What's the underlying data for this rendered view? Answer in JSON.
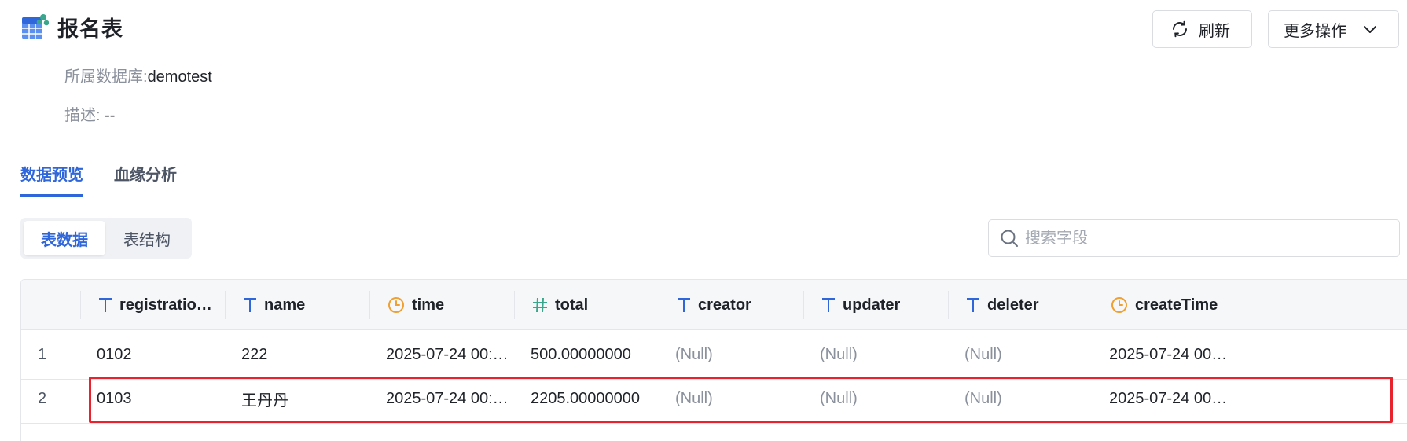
{
  "header": {
    "title": "报名表",
    "db_label": "所属数据库:",
    "db_value": "demotest",
    "desc_label": "描述:",
    "desc_value": "--"
  },
  "actions": {
    "refresh_label": "刷新",
    "more_label": "更多操作"
  },
  "tabs": [
    {
      "label": "数据预览",
      "active": true
    },
    {
      "label": "血缘分析",
      "active": false
    }
  ],
  "segment": {
    "items": [
      {
        "label": "表数据",
        "active": true
      },
      {
        "label": "表结构",
        "active": false
      }
    ]
  },
  "search": {
    "placeholder": "搜索字段",
    "value": ""
  },
  "table": {
    "columns": [
      {
        "label": "registratio…",
        "type": "text"
      },
      {
        "label": "name",
        "type": "text"
      },
      {
        "label": "time",
        "type": "datetime"
      },
      {
        "label": "total",
        "type": "number"
      },
      {
        "label": "creator",
        "type": "text"
      },
      {
        "label": "updater",
        "type": "text"
      },
      {
        "label": "deleter",
        "type": "text"
      },
      {
        "label": "createTime",
        "type": "datetime"
      }
    ],
    "rows": [
      {
        "index": "1",
        "cells": [
          "0102",
          "222",
          "2025-07-24 00:…",
          "500.00000000",
          "(Null)",
          "(Null)",
          "(Null)",
          "2025-07-24 00:…"
        ],
        "selected": false
      },
      {
        "index": "2",
        "cells": [
          "0103",
          "王丹丹",
          "2025-07-24 00:…",
          "2205.00000000",
          "(Null)",
          "(Null)",
          "(Null)",
          "2025-07-24 00:…"
        ],
        "selected": true
      }
    ]
  },
  "colors": {
    "accent": "#2f66d9",
    "highlight": "#e8232e",
    "datetime_icon": "#f0a030",
    "number_icon": "#3aa68c",
    "text_icon": "#2f66d9"
  }
}
